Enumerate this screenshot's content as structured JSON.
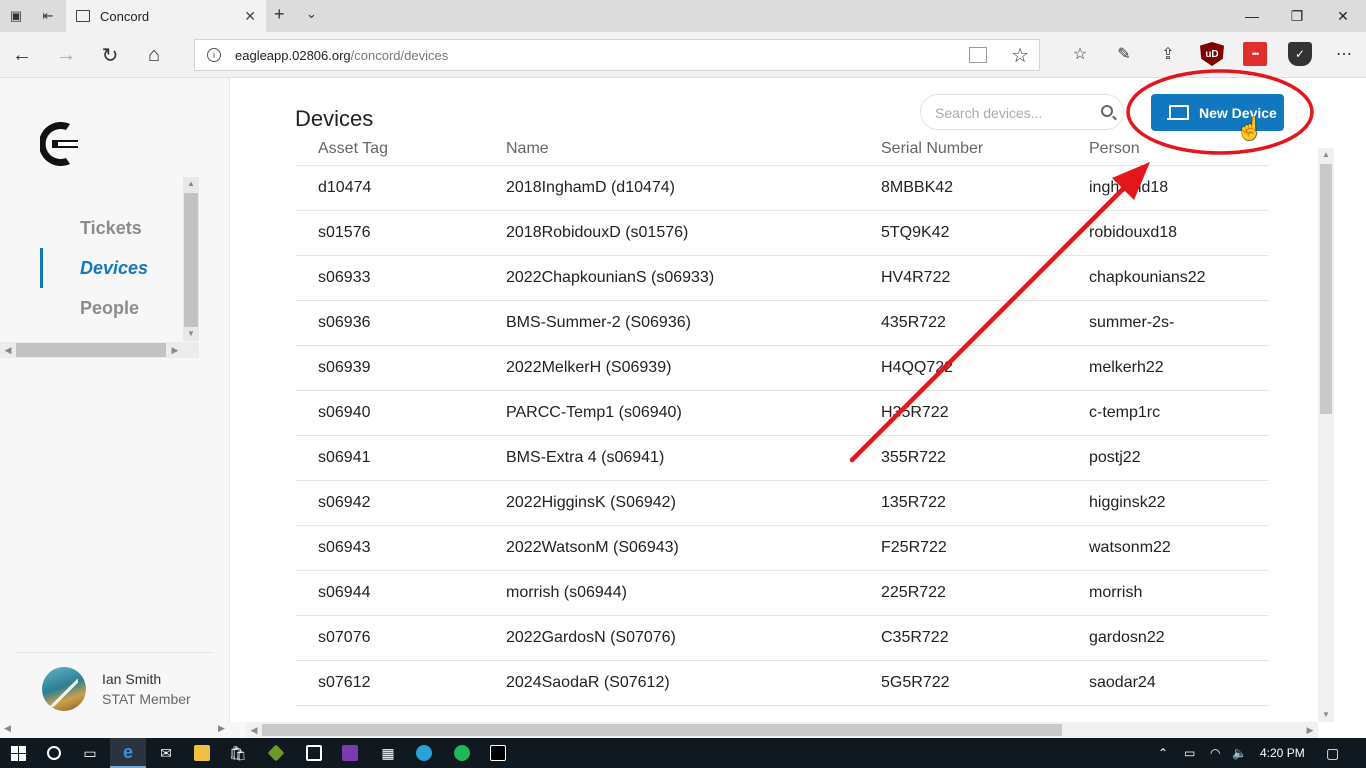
{
  "browser": {
    "tab_title": "Concord",
    "url_host": "eagleapp.02806.org",
    "url_path": "/concord/devices"
  },
  "sidebar": {
    "nav": [
      {
        "label": "Tickets",
        "active": false
      },
      {
        "label": "Devices",
        "active": true
      },
      {
        "label": "People",
        "active": false
      }
    ],
    "user": {
      "name": "Ian Smith",
      "role": "STAT Member"
    }
  },
  "main": {
    "title": "Devices",
    "search_placeholder": "Search devices...",
    "new_button_label": "New Device",
    "columns": [
      "Asset Tag",
      "Name",
      "Serial Number",
      "Person"
    ],
    "rows": [
      [
        "d10474",
        "2018InghamD (d10474)",
        "8MBBK42",
        "inghamd18"
      ],
      [
        "s01576",
        "2018RobidouxD (s01576)",
        "5TQ9K42",
        "robidouxd18"
      ],
      [
        "s06933",
        "2022ChapkounianS (s06933)",
        "HV4R722",
        "chapkounians22"
      ],
      [
        "s06936",
        "BMS-Summer-2 (S06936)",
        "435R722",
        "summer-2s-"
      ],
      [
        "s06939",
        "2022MelkerH (S06939)",
        "H4QQ722",
        "melkerh22"
      ],
      [
        "s06940",
        "PARCC-Temp1 (s06940)",
        "H35R722",
        "c-temp1rc"
      ],
      [
        "s06941",
        "BMS-Extra 4 (s06941)",
        "355R722",
        "postj22"
      ],
      [
        "s06942",
        "2022HigginsK (S06942)",
        "135R722",
        "higginsk22"
      ],
      [
        "s06943",
        "2022WatsonM (S06943)",
        "F25R722",
        "watsonm22"
      ],
      [
        "s06944",
        "morrish (s06944)",
        "225R722",
        "morrish"
      ],
      [
        "s07076",
        "2022GardosN (S07076)",
        "C35R722",
        "gardosn22"
      ],
      [
        "s07612",
        "2024SaodaR (S07612)",
        "5G5R722",
        "saodar24"
      ]
    ]
  },
  "taskbar": {
    "clock": "4:20 PM"
  },
  "colors": {
    "accent": "#1178c0",
    "annotation": "#e3161b"
  }
}
